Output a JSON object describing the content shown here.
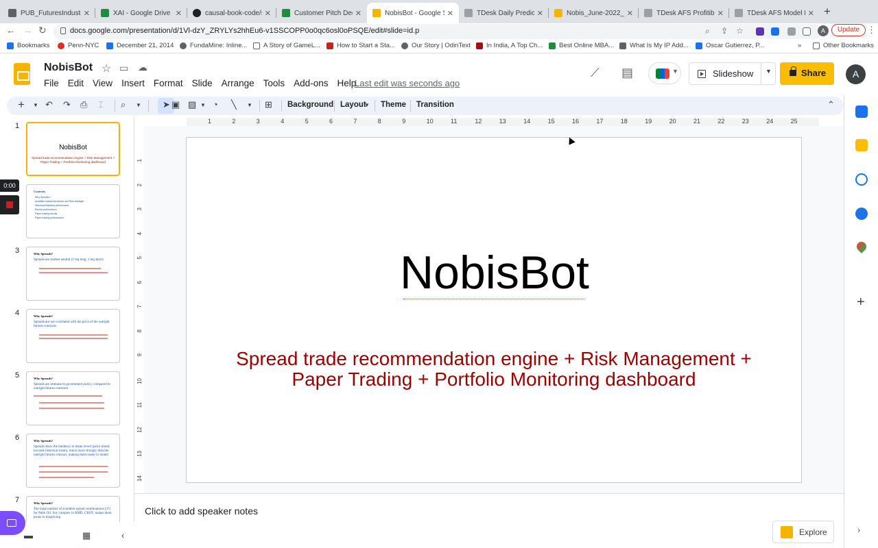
{
  "browser": {
    "tabs": [
      {
        "title": "PUB_FuturesIndustry",
        "color": "#5f6368"
      },
      {
        "title": "XAI - Google Drive",
        "color": "#1e8e3e"
      },
      {
        "title": "causal-book-code/sr",
        "color": "#202124"
      },
      {
        "title": "Customer Pitch Deck",
        "color": "#1e8e3e"
      },
      {
        "title": "NobisBot - Google Sl",
        "color": "#f4b400"
      },
      {
        "title": "TDesk Daily Predictio",
        "color": "#9aa0a6"
      },
      {
        "title": "Nobis_June-2022_P",
        "color": "#f4b400"
      },
      {
        "title": "TDesk AFS Profitible",
        "color": "#9aa0a6"
      },
      {
        "title": "TDesk AFS Model Ex",
        "color": "#9aa0a6"
      }
    ],
    "url": "docs.google.com/presentation/d/1Vl-dzY_ZRYLYs2hhEu6-v1SSCOPP0o0qc6osl0oPSQE/edit#slide=id.p",
    "account_initial": "A",
    "update_label": "Update",
    "bookmarks": [
      {
        "label": "Bookmarks",
        "color": "#1a73e8"
      },
      {
        "label": "Penn-NYC",
        "color": "#d93025"
      },
      {
        "label": "December 21, 2014",
        "color": "#1a73e8"
      },
      {
        "label": "FundaMine: Inline...",
        "color": "#5f6368"
      },
      {
        "label": "A Story of GameL...",
        "color": "#5f6368"
      },
      {
        "label": "How to Start a Sta...",
        "color": "#c5221f"
      },
      {
        "label": "Our Story | OdinText",
        "color": "#5f6368"
      },
      {
        "label": "In India, A Top Ch...",
        "color": "#a50e0e"
      },
      {
        "label": "Best Online MBA...",
        "color": "#1e8e3e"
      },
      {
        "label": "What Is My IP Add...",
        "color": "#5f6368"
      },
      {
        "label": "Oscar Gutierrez, P...",
        "color": "#1a73e8"
      }
    ],
    "bookmarks_more": "»",
    "other_bookmarks": "Other Bookmarks"
  },
  "app": {
    "title": "NobisBot",
    "menu": [
      "File",
      "Edit",
      "View",
      "Insert",
      "Format",
      "Slide",
      "Arrange",
      "Tools",
      "Add-ons",
      "Help"
    ],
    "last_edit": "Last edit was seconds ago",
    "slideshow_label": "Slideshow",
    "share_label": "Share",
    "avatar_initial": "A"
  },
  "toolbar": {
    "background": "Background",
    "layout": "Layout",
    "theme": "Theme",
    "transition": "Transition"
  },
  "filmstrip": {
    "timer": "0:00",
    "slides": [
      {
        "num": "1",
        "title": "NobisBot",
        "subtitle": "Spread trade recommendation engine + Risk Management + Paper Trading + Portfolio Monitoring dashboard"
      },
      {
        "num": "",
        "heading": "Contents",
        "bullets": [
          "Why Spreads?",
          "Available spread structures and Risk Manager",
          "Historical Backtest performance",
          "Recent performance",
          "Paper trading results",
          "Paper trading performance"
        ]
      },
      {
        "num": "3",
        "heading": "Why Spreads?",
        "body": "Spreads are market neutral (1 leg long, 1 leg short)"
      },
      {
        "num": "4",
        "heading": "Why Spreads?",
        "body": "Spreads are not correlated with the price of the outright futures contracts"
      },
      {
        "num": "5",
        "heading": "Why Spreads?",
        "body": "Spreads are immune to government policy, compared to outright futures contracts"
      },
      {
        "num": "6",
        "heading": "Why Spreads?",
        "body": "Spreads show the tendency to mean revert (price trends towards historical mean), much more strongly than the outright futures contract, making them easier to model"
      },
      {
        "num": "7",
        "heading": "Why Spreads?",
        "body": "The large number of available spread combinations (37) for Palm Oil, Soy complex in BMD, CBOT, makes them prone to mispricing"
      }
    ]
  },
  "ruler": {
    "h": [
      "1",
      "2",
      "3",
      "4",
      "5",
      "6",
      "7",
      "8",
      "9",
      "10",
      "11",
      "12",
      "13",
      "14",
      "15",
      "16",
      "17",
      "18",
      "19",
      "20",
      "21",
      "22",
      "23",
      "24",
      "25"
    ],
    "v": [
      "1",
      "2",
      "3",
      "4",
      "5",
      "6",
      "7",
      "8",
      "9",
      "10",
      "11",
      "12",
      "13",
      "14"
    ]
  },
  "slide": {
    "title": "NobisBot",
    "subtitle": "Spread trade recommendation engine + Risk Management + Paper Trading + Portfolio Monitoring dashboard"
  },
  "notes": {
    "placeholder": "Click to add speaker notes"
  },
  "explore": {
    "label": "Explore"
  }
}
